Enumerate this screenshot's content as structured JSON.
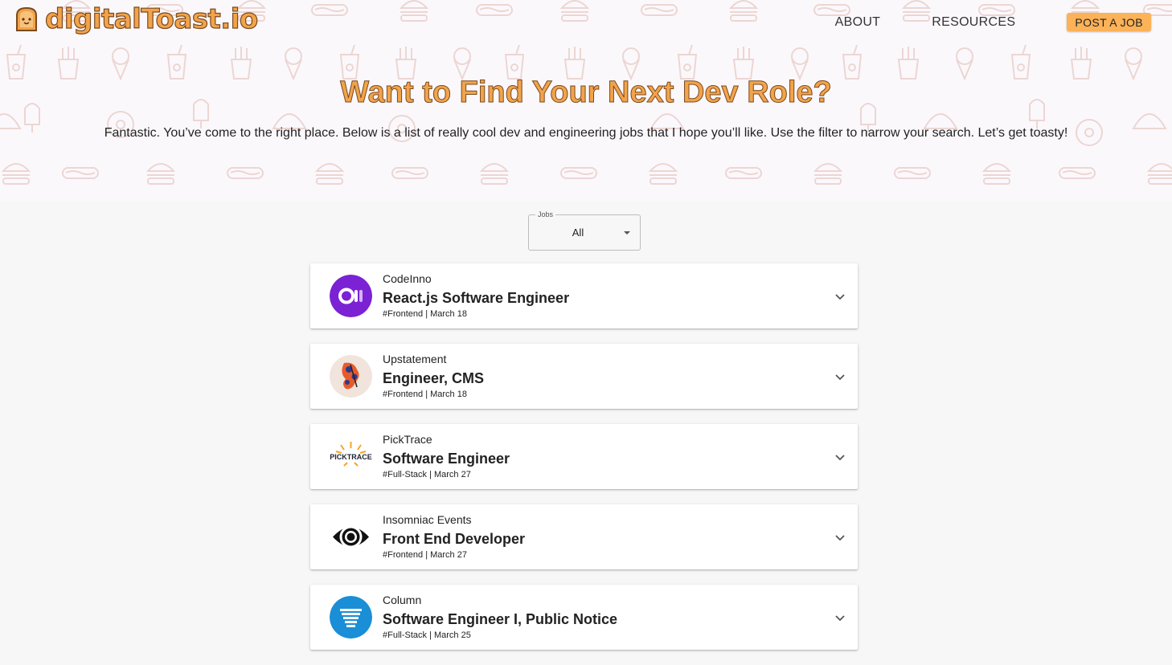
{
  "app": {
    "logo_text": "digitalToast.io",
    "brand_color": "#f2a34a",
    "accent_button_color": "#fbb258"
  },
  "nav": {
    "about": "ABOUT",
    "resources": "RESOURCES",
    "post_job": "POST A JOB"
  },
  "hero": {
    "title": "Want to Find Your Next Dev Role?",
    "subtitle": "Fantastic. You’ve come to the right place. Below is a list of really cool dev and engineering jobs that I hope you’ll like. Use the filter to narrow your search. Let’s get toasty!"
  },
  "filter": {
    "label": "Jobs",
    "value": "All"
  },
  "jobs": [
    {
      "company": "CodeInno",
      "title": "React.js Software Engineer",
      "meta": "#Frontend | March 18",
      "logo_icon": "codeinno-logo-icon"
    },
    {
      "company": "Upstatement",
      "title": "Engineer, CMS",
      "meta": "#Frontend | March 18",
      "logo_icon": "upstatement-logo-icon"
    },
    {
      "company": "PickTrace",
      "title": "Software Engineer",
      "meta": "#Full-Stack | March 27",
      "logo_icon": "picktrace-logo-icon",
      "logo_text": "PICKTRACE"
    },
    {
      "company": "Insomniac Events",
      "title": "Front End Developer",
      "meta": "#Frontend | March 27",
      "logo_icon": "insomniac-logo-icon"
    },
    {
      "company": "Column",
      "title": "Software Engineer I, Public Notice",
      "meta": "#Full-Stack | March 25",
      "logo_icon": "column-logo-icon"
    }
  ]
}
